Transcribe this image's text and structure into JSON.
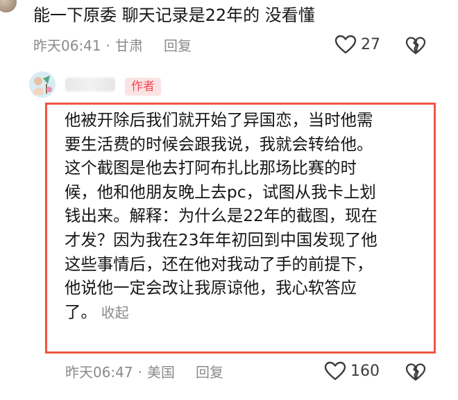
{
  "comment1": {
    "text": "能一下原委 聊天记录是22年的 没看懂",
    "time": "昨天06:41",
    "location": "甘肃",
    "reply_label": "回复",
    "likes": "27"
  },
  "comment2": {
    "author_badge": "作者",
    "lines": [
      "他被开除后我们就开始了异国恋，当时他需",
      "要生活费的时候会跟我说，我就会转给他。",
      "这个截图是他去打阿布扎比那场比赛的时",
      "候，他和他朋友晚上去pc，试图从我卡上划",
      "钱出来。解释：为什么是22年的截图，现在",
      "才发？因为我在23年年初回到中国发现了他",
      "这些事情后，还在他对我动了手的前提下，",
      "他说他一定会改让我原谅他，我心软答应",
      "了。"
    ],
    "collapse_label": "收起",
    "time": "昨天06:47",
    "location": "美国",
    "reply_label": "回复",
    "likes": "160"
  },
  "colors": {
    "highlight_border": "#f05442",
    "badge_bg": "#fbe3e4",
    "badge_text": "#f04a55",
    "meta_text": "#8a8a8a"
  },
  "icons": {
    "like": "heart-outline-icon",
    "dislike": "broken-heart-icon"
  }
}
